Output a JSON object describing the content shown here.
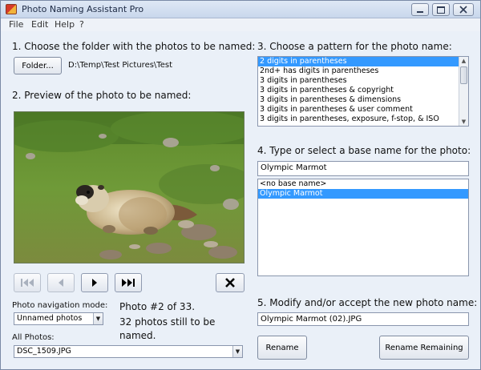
{
  "window": {
    "title": "Photo Naming Assistant Pro"
  },
  "menu": [
    "File",
    "Edit",
    "Help",
    "?"
  ],
  "step1": {
    "label": "1. Choose the folder with the photos to be named:",
    "folder_button": "Folder...",
    "folder_path": "D:\\Temp\\Test Pictures\\Test"
  },
  "step2": {
    "label": "2. Preview of the photo to be named:"
  },
  "step3": {
    "label": "3. Choose a pattern for the photo name:",
    "patterns": [
      {
        "text": "2 digits in parentheses",
        "selected": true
      },
      {
        "text": "2nd+ has digits in parentheses",
        "selected": false
      },
      {
        "text": "3 digits in parentheses",
        "selected": false
      },
      {
        "text": "3 digits in parentheses & copyright",
        "selected": false
      },
      {
        "text": "3 digits in parentheses & dimensions",
        "selected": false
      },
      {
        "text": "3 digits in parentheses & user comment",
        "selected": false
      },
      {
        "text": "3 digits in parentheses, exposure, f-stop, & ISO",
        "selected": false
      }
    ]
  },
  "step4": {
    "label": "4. Type or select a base name for the photo:",
    "base_name_value": "Olympic Marmot",
    "base_names": [
      {
        "text": "<no base name>",
        "selected": false
      },
      {
        "text": "Olympic Marmot",
        "selected": true
      }
    ]
  },
  "navigation": {
    "mode_label": "Photo navigation mode:",
    "mode_value": "Unnamed photos",
    "status_line1": "Photo #2 of 33.",
    "status_line2": "32 photos still to be",
    "status_line3": "named."
  },
  "all_photos": {
    "label": "All Photos:",
    "value": "DSC_1509.JPG"
  },
  "step5": {
    "label": "5. Modify and/or accept the new photo name:",
    "new_name_value": "Olympic Marmot (02).JPG",
    "rename_button": "Rename",
    "rename_remaining_button": "Rename Remaining"
  },
  "icons": {
    "first": "skip-to-first-icon",
    "previous": "previous-icon",
    "next": "next-icon",
    "last": "skip-to-last-icon",
    "delete": "delete-x-icon"
  },
  "colors": {
    "selection": "#3399ff",
    "window_bg": "#eaf0f8"
  }
}
